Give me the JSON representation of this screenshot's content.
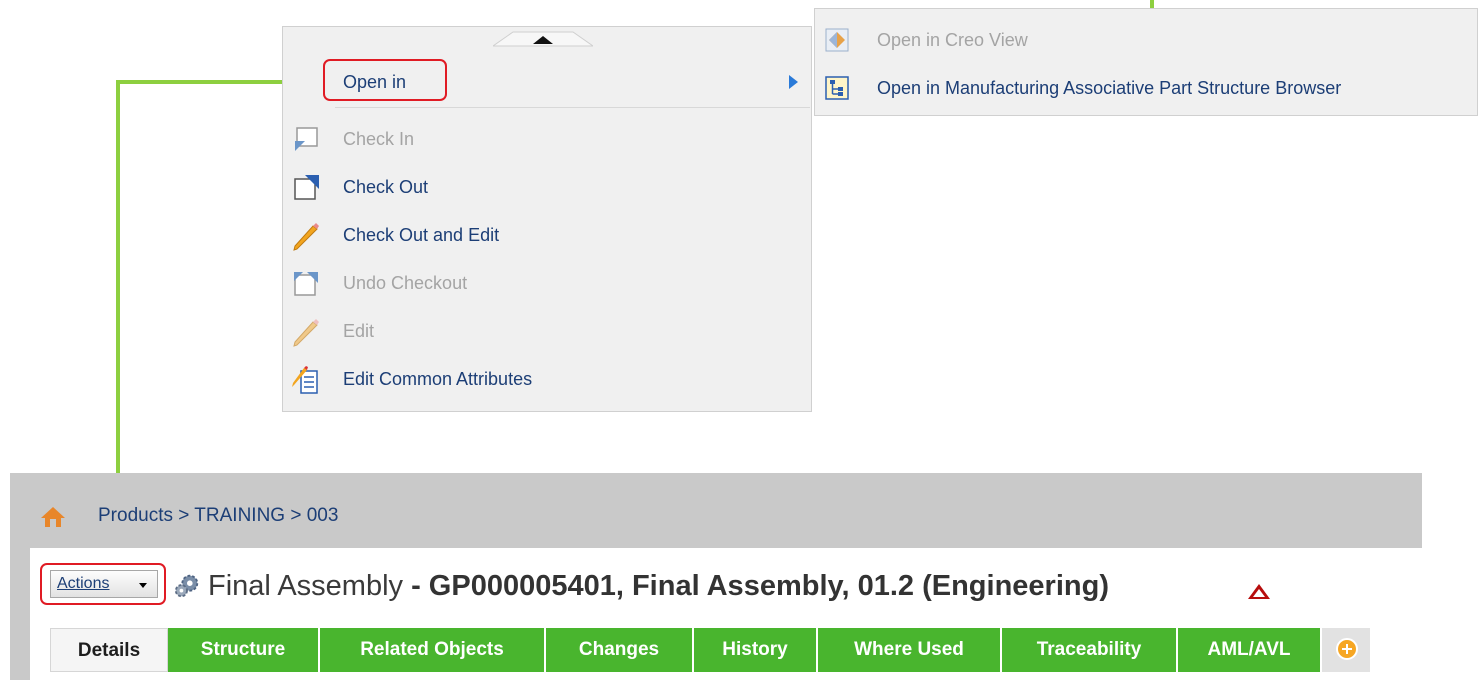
{
  "context_menu": {
    "items": [
      {
        "label": "Open in",
        "enabled": true,
        "has_submenu": true,
        "icon": "none"
      },
      {
        "label": "Check In",
        "enabled": false,
        "icon": "check-in-icon"
      },
      {
        "label": "Check Out",
        "enabled": true,
        "icon": "check-out-icon"
      },
      {
        "label": "Check Out and Edit",
        "enabled": true,
        "icon": "pencil-icon"
      },
      {
        "label": "Undo Checkout",
        "enabled": false,
        "icon": "undo-checkout-icon"
      },
      {
        "label": "Edit",
        "enabled": false,
        "icon": "pencil-icon"
      },
      {
        "label": "Edit Common Attributes",
        "enabled": true,
        "icon": "edit-attributes-icon"
      }
    ]
  },
  "submenu": {
    "items": [
      {
        "label": "Open in Creo View",
        "enabled": false,
        "icon": "creo-view-icon"
      },
      {
        "label": "Open in Manufacturing Associative Part Structure Browser",
        "enabled": true,
        "icon": "structure-browser-icon"
      }
    ]
  },
  "breadcrumb": "Products > TRAINING > 003",
  "actions_label": "Actions",
  "title": {
    "name": "Final Assembly",
    "separator": " - ",
    "identifier": "GP000005401, Final Assembly, 01.2 (Engineering)"
  },
  "tabs": [
    {
      "label": "Details",
      "active": true
    },
    {
      "label": "Structure",
      "active": false
    },
    {
      "label": "Related Objects",
      "active": false
    },
    {
      "label": "Changes",
      "active": false
    },
    {
      "label": "History",
      "active": false
    },
    {
      "label": "Where Used",
      "active": false
    },
    {
      "label": "Traceability",
      "active": false
    },
    {
      "label": "AML/AVL",
      "active": false
    }
  ],
  "colors": {
    "callout_line": "#8dcf3f",
    "highlight_box": "#e01b24",
    "tab_green": "#49b52e",
    "link_blue": "#1c3e76"
  }
}
